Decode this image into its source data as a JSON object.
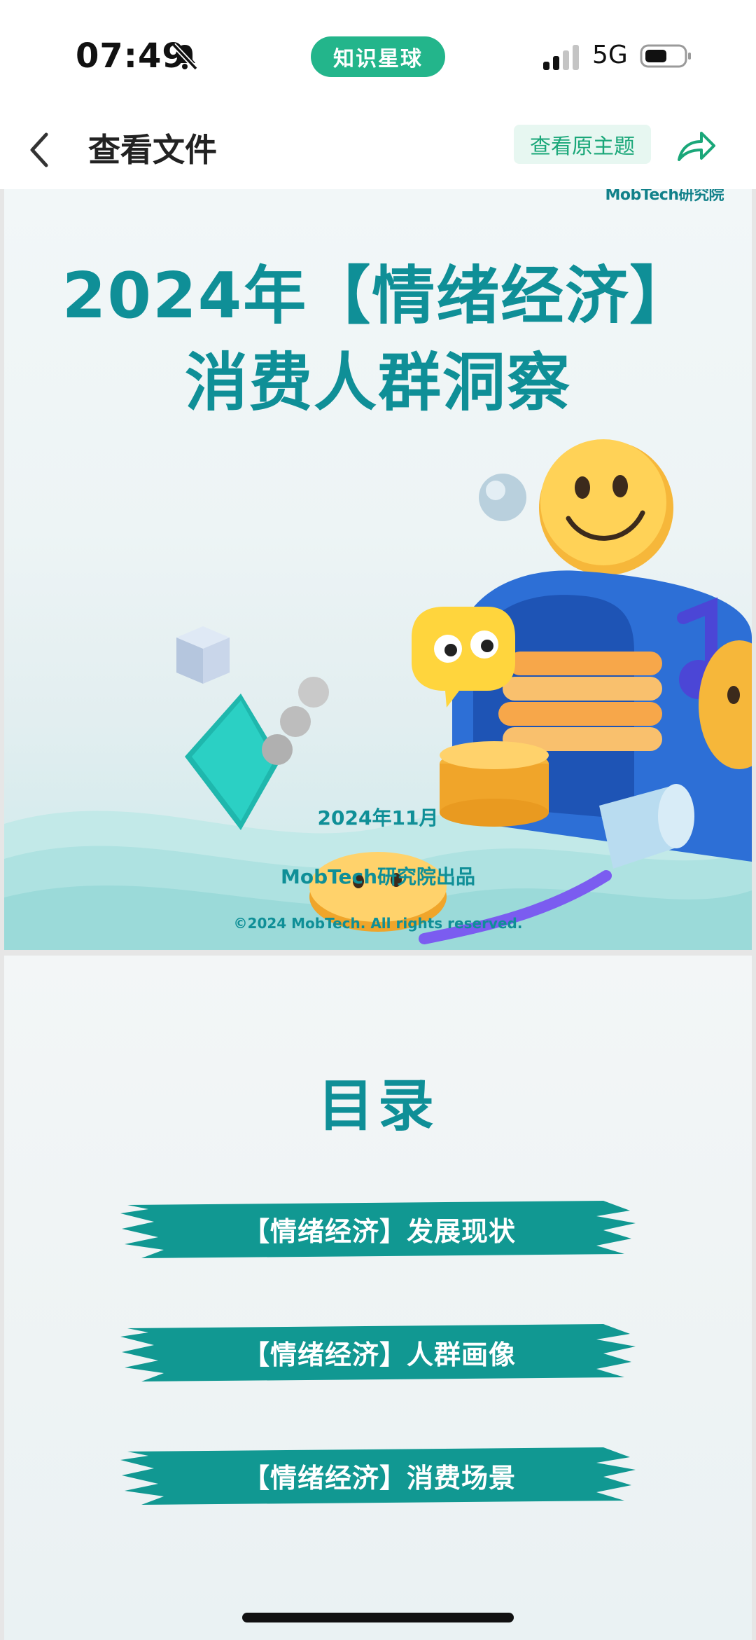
{
  "status_bar": {
    "time": "07:49",
    "app_pill": "知识星球",
    "network": "5G",
    "icons": [
      "bell-slash-icon",
      "signal-icon",
      "battery-icon"
    ]
  },
  "header": {
    "title": "查看文件",
    "view_original": "查看原主题",
    "icons": [
      "back-chevron-icon",
      "share-icon"
    ]
  },
  "cover": {
    "brand": "MobTech研究院",
    "title_line1": "2024年【情绪经济】",
    "title_line2": "消费人群洞察",
    "date": "2024年11月",
    "producer": "MobTech研究院出品",
    "copyright": "©2024 MobTech. All rights reserved."
  },
  "toc": {
    "title": "目录",
    "items": [
      "【情绪经济】发展现状",
      "【情绪经济】人群画像",
      "【情绪经济】消费场景"
    ]
  },
  "colors": {
    "accent": "#0f8f97",
    "pill_green": "#23b58b",
    "link_green": "#1aa779"
  }
}
